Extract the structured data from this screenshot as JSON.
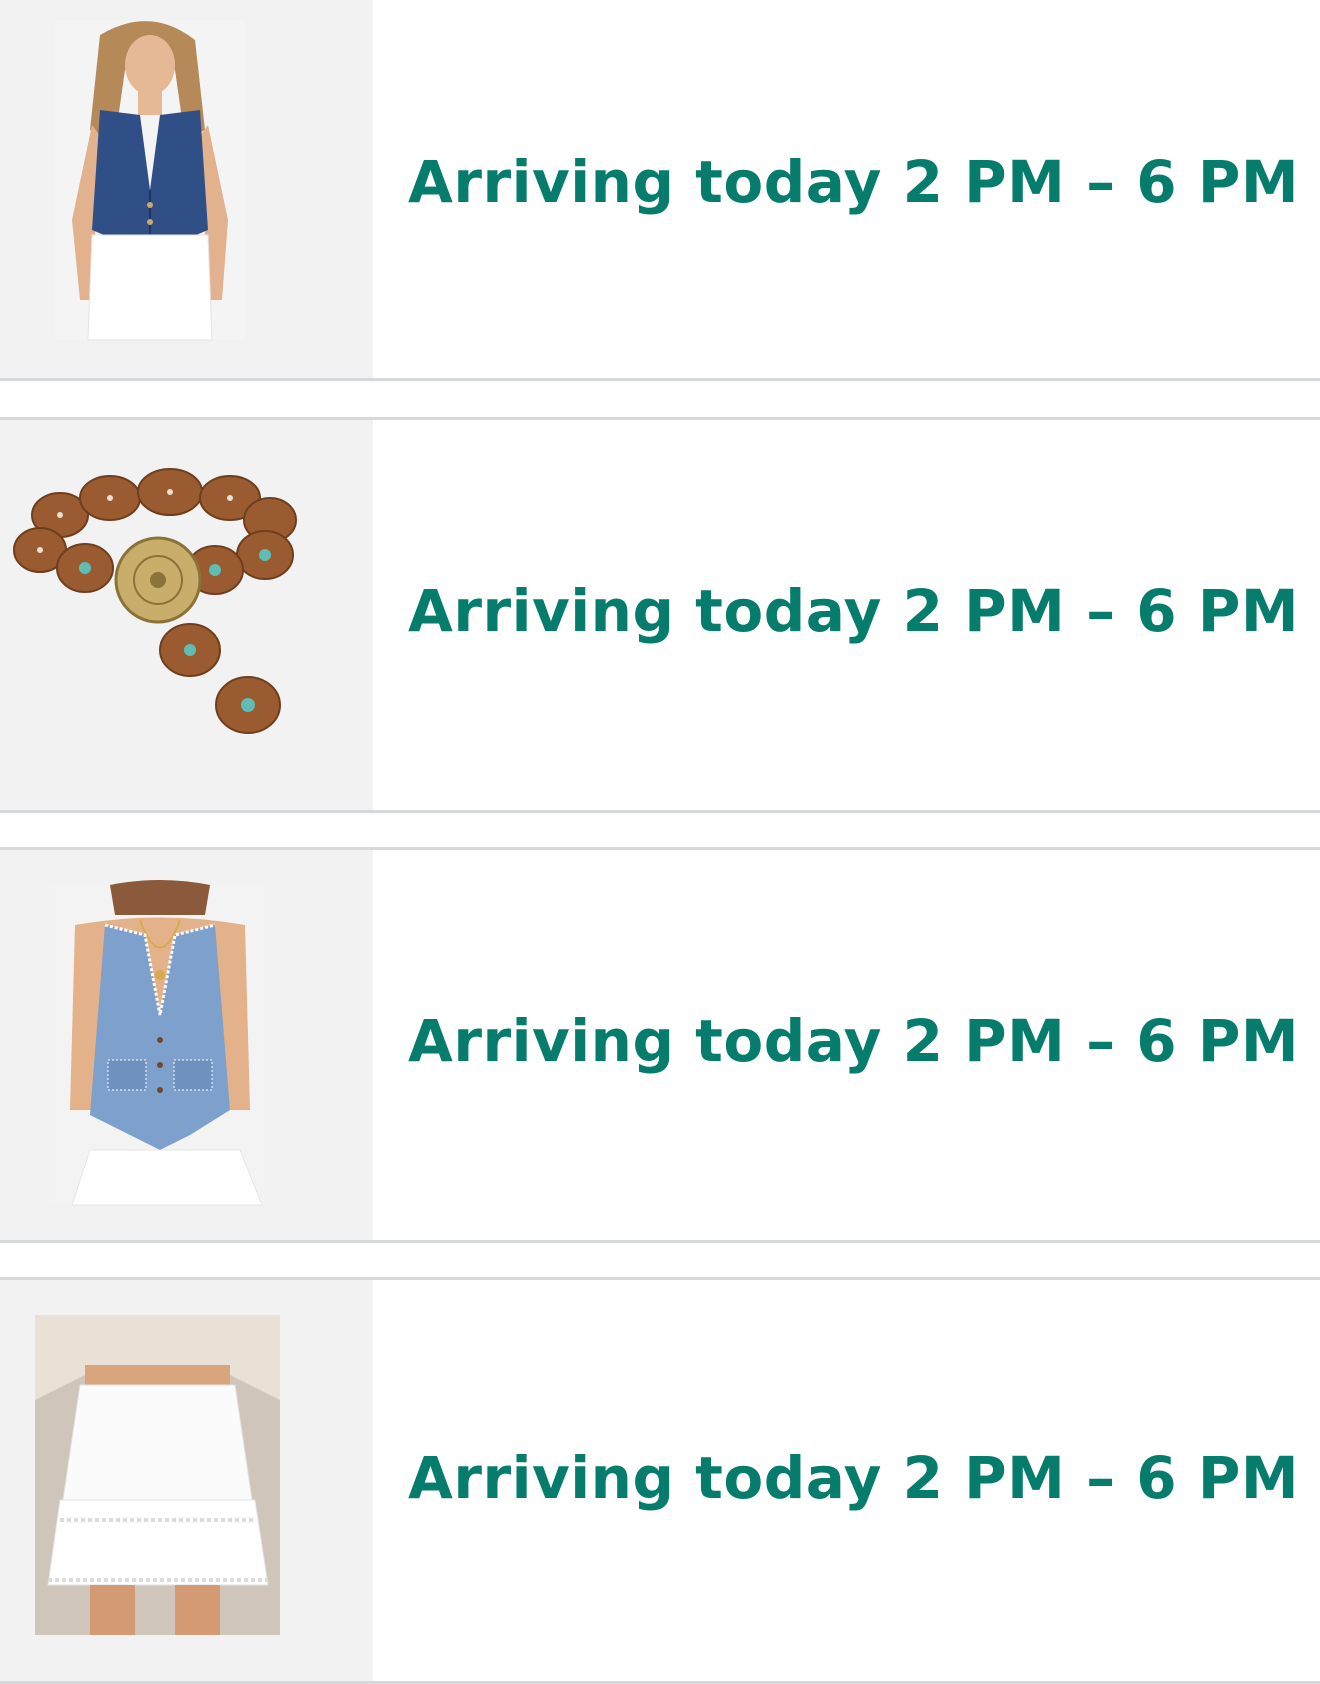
{
  "orders": [
    {
      "delivery": "Arriving today 2 PM – 6 PM",
      "image_icon": "dark-denim-vest-icon"
    },
    {
      "delivery": "Arriving today 2 PM – 6 PM",
      "image_icon": "concho-belt-icon"
    },
    {
      "delivery": "Arriving today 2 PM – 6 PM",
      "image_icon": "light-denim-vest-icon"
    },
    {
      "delivery": "Arriving today 2 PM – 6 PM",
      "image_icon": "white-ruffle-skirt-icon"
    }
  ],
  "colors": {
    "delivery_text": "#067d6c",
    "divider": "#d5d9dc",
    "thumb_bg": "#f2f2f2"
  }
}
